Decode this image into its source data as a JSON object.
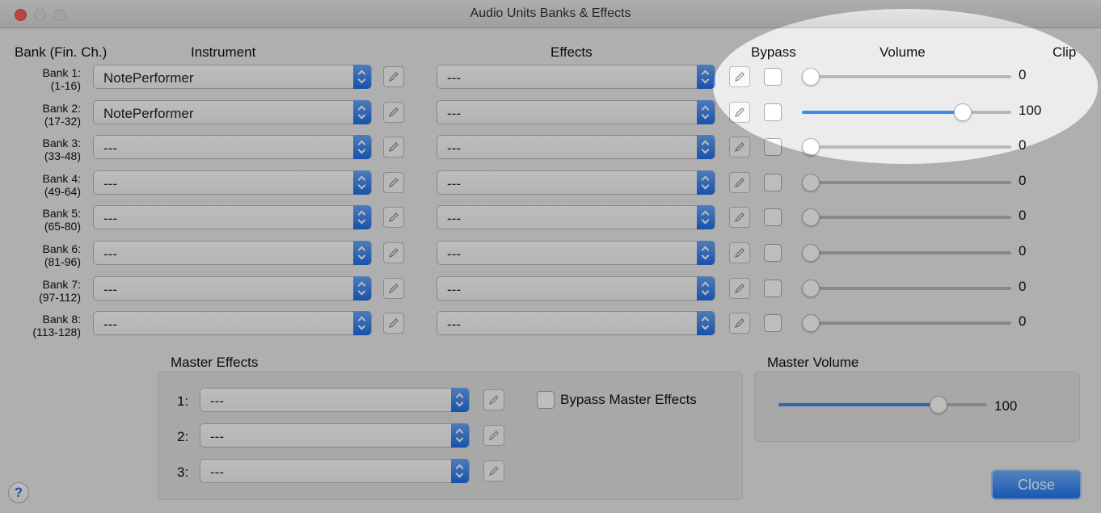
{
  "window": {
    "title": "Audio Units Banks & Effects"
  },
  "headers": {
    "bank": "Bank (Fin. Ch.)",
    "instrument": "Instrument",
    "effects": "Effects",
    "bypass": "Bypass",
    "volume": "Volume",
    "clip": "Clip"
  },
  "banks": [
    {
      "name": "Bank 1:",
      "channels": "(1-16)",
      "instrument": "NotePerformer",
      "effect": "---",
      "bypass": false,
      "volume": 0,
      "volume_label": "0"
    },
    {
      "name": "Bank 2:",
      "channels": "(17-32)",
      "instrument": "NotePerformer",
      "effect": "---",
      "bypass": false,
      "volume": 100,
      "volume_label": "100"
    },
    {
      "name": "Bank 3:",
      "channels": "(33-48)",
      "instrument": "---",
      "effect": "---",
      "bypass": false,
      "volume": 0,
      "volume_label": "0"
    },
    {
      "name": "Bank 4:",
      "channels": "(49-64)",
      "instrument": "---",
      "effect": "---",
      "bypass": false,
      "volume": 0,
      "volume_label": "0"
    },
    {
      "name": "Bank 5:",
      "channels": "(65-80)",
      "instrument": "---",
      "effect": "---",
      "bypass": false,
      "volume": 0,
      "volume_label": "0"
    },
    {
      "name": "Bank 6:",
      "channels": "(81-96)",
      "instrument": "---",
      "effect": "---",
      "bypass": false,
      "volume": 0,
      "volume_label": "0"
    },
    {
      "name": "Bank 7:",
      "channels": "(97-112)",
      "instrument": "---",
      "effect": "---",
      "bypass": false,
      "volume": 0,
      "volume_label": "0"
    },
    {
      "name": "Bank 8:",
      "channels": "(113-128)",
      "instrument": "---",
      "effect": "---",
      "bypass": false,
      "volume": 0,
      "volume_label": "0"
    }
  ],
  "master_effects": {
    "title": "Master Effects",
    "slots": [
      {
        "index": "1:",
        "value": "---"
      },
      {
        "index": "2:",
        "value": "---"
      },
      {
        "index": "3:",
        "value": "---"
      }
    ],
    "bypass_label": "Bypass Master Effects",
    "bypass": false
  },
  "master_volume": {
    "title": "Master Volume",
    "value": 100,
    "label": "100"
  },
  "buttons": {
    "help": "?",
    "close": "Close"
  },
  "colors": {
    "accent": "#1f6ee9",
    "slider_fill": "#3b8eee"
  }
}
